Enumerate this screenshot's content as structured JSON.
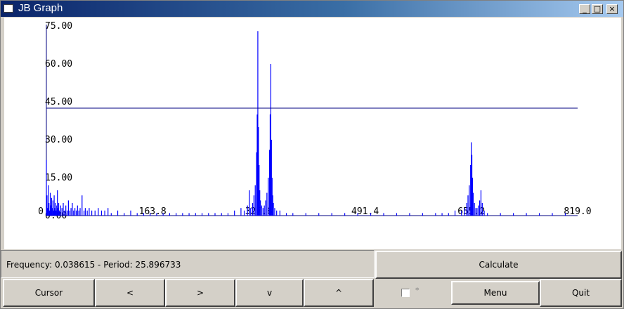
{
  "window": {
    "title": "JB Graph",
    "controls": {
      "minimize": "_",
      "maximize": "□",
      "close": "×"
    }
  },
  "chart_data": {
    "type": "line",
    "title": "",
    "xlabel": "",
    "ylabel": "",
    "xlim": [
      0,
      819.0
    ],
    "ylim": [
      0,
      75.0
    ],
    "x_ticks": [
      "0",
      "163.8",
      "327.6",
      "491.4",
      "655.2",
      "819.0"
    ],
    "y_ticks": [
      "0.00",
      "15.00",
      "30.00",
      "45.00",
      "60.00",
      "75.00"
    ],
    "cursor_line_y": 42.5,
    "series": [
      {
        "color": "#0000ff",
        "points": [
          [
            0,
            22
          ],
          [
            1,
            8
          ],
          [
            2,
            3
          ],
          [
            3,
            12
          ],
          [
            4,
            5
          ],
          [
            5,
            2
          ],
          [
            6,
            9
          ],
          [
            7,
            4
          ],
          [
            8,
            7
          ],
          [
            9,
            3
          ],
          [
            10,
            6
          ],
          [
            11,
            2
          ],
          [
            12,
            8
          ],
          [
            13,
            3
          ],
          [
            14,
            5
          ],
          [
            15,
            2
          ],
          [
            16,
            4
          ],
          [
            17,
            10
          ],
          [
            18,
            3
          ],
          [
            19,
            5
          ],
          [
            20,
            2
          ],
          [
            22,
            4
          ],
          [
            24,
            3
          ],
          [
            26,
            5
          ],
          [
            28,
            2
          ],
          [
            30,
            4
          ],
          [
            32,
            2
          ],
          [
            34,
            6
          ],
          [
            36,
            2
          ],
          [
            38,
            3
          ],
          [
            40,
            5
          ],
          [
            42,
            2
          ],
          [
            44,
            3
          ],
          [
            46,
            2
          ],
          [
            48,
            4
          ],
          [
            50,
            2
          ],
          [
            52,
            3
          ],
          [
            55,
            8
          ],
          [
            58,
            2
          ],
          [
            60,
            3
          ],
          [
            63,
            2
          ],
          [
            66,
            3
          ],
          [
            70,
            2
          ],
          [
            75,
            2
          ],
          [
            80,
            3
          ],
          [
            85,
            2
          ],
          [
            90,
            2
          ],
          [
            95,
            3
          ],
          [
            100,
            1
          ],
          [
            110,
            2
          ],
          [
            120,
            1
          ],
          [
            130,
            2
          ],
          [
            140,
            1
          ],
          [
            150,
            1
          ],
          [
            160,
            1
          ],
          [
            170,
            1
          ],
          [
            180,
            1
          ],
          [
            190,
            1
          ],
          [
            200,
            1
          ],
          [
            210,
            1
          ],
          [
            220,
            1
          ],
          [
            230,
            1
          ],
          [
            240,
            1
          ],
          [
            250,
            1
          ],
          [
            260,
            1
          ],
          [
            270,
            1
          ],
          [
            280,
            1
          ],
          [
            290,
            2
          ],
          [
            300,
            3
          ],
          [
            305,
            2
          ],
          [
            310,
            4
          ],
          [
            313,
            10
          ],
          [
            315,
            3
          ],
          [
            318,
            5
          ],
          [
            320,
            8
          ],
          [
            322,
            12
          ],
          [
            324,
            25
          ],
          [
            325,
            40
          ],
          [
            326,
            73
          ],
          [
            327,
            35
          ],
          [
            328,
            20
          ],
          [
            329,
            10
          ],
          [
            330,
            6
          ],
          [
            332,
            4
          ],
          [
            334,
            3
          ],
          [
            336,
            4
          ],
          [
            338,
            6
          ],
          [
            340,
            9
          ],
          [
            342,
            15
          ],
          [
            344,
            26
          ],
          [
            345,
            40
          ],
          [
            346,
            60
          ],
          [
            347,
            30
          ],
          [
            348,
            15
          ],
          [
            349,
            8
          ],
          [
            350,
            5
          ],
          [
            352,
            3
          ],
          [
            355,
            2
          ],
          [
            360,
            2
          ],
          [
            370,
            1
          ],
          [
            380,
            1
          ],
          [
            400,
            1
          ],
          [
            420,
            1
          ],
          [
            440,
            1
          ],
          [
            460,
            1
          ],
          [
            480,
            1
          ],
          [
            500,
            1
          ],
          [
            520,
            1
          ],
          [
            540,
            1
          ],
          [
            560,
            1
          ],
          [
            580,
            1
          ],
          [
            600,
            1
          ],
          [
            610,
            1
          ],
          [
            620,
            1
          ],
          [
            630,
            2
          ],
          [
            640,
            2
          ],
          [
            645,
            3
          ],
          [
            648,
            5
          ],
          [
            650,
            8
          ],
          [
            652,
            12
          ],
          [
            654,
            20
          ],
          [
            655,
            29
          ],
          [
            656,
            24
          ],
          [
            657,
            15
          ],
          [
            658,
            9
          ],
          [
            660,
            5
          ],
          [
            662,
            3
          ],
          [
            664,
            3
          ],
          [
            666,
            4
          ],
          [
            668,
            6
          ],
          [
            670,
            10
          ],
          [
            672,
            5
          ],
          [
            675,
            2
          ],
          [
            680,
            1
          ],
          [
            700,
            1
          ],
          [
            720,
            1
          ],
          [
            740,
            1
          ],
          [
            760,
            1
          ],
          [
            780,
            1
          ],
          [
            800,
            1
          ],
          [
            819,
            0
          ]
        ]
      }
    ]
  },
  "status": {
    "text": "Frequency: 0.038615 - Period: 25.896733"
  },
  "buttons": {
    "calculate": "Calculate",
    "cursor": "Cursor",
    "left": "<",
    "right": ">",
    "down": "v",
    "up": "^",
    "menu": "Menu",
    "quit": "Quit"
  },
  "checkbox": {
    "label": "*"
  }
}
